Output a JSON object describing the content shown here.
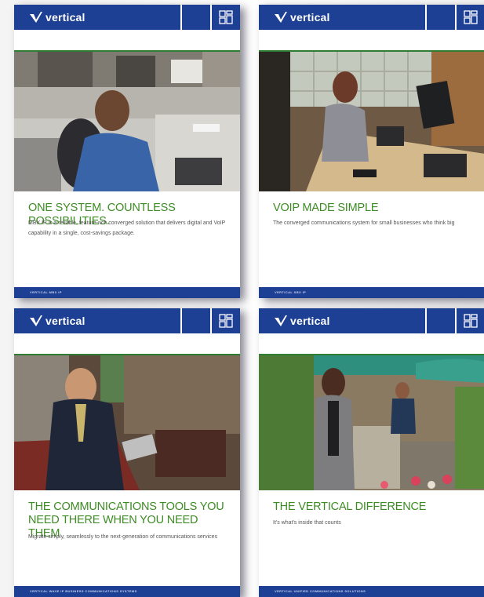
{
  "brand": {
    "logo_text": "vertical",
    "colors": {
      "primary": "#1d3f94",
      "headline": "#3d8b24",
      "body": "#555555"
    }
  },
  "brochures": [
    {
      "headline": "ONE SYSTEM. COUNTLESS POSSIBILITIES.",
      "body": "MBX IP is a reliable, feature-rich converged solution that delivers digital and VoIP capability in a single, cost-savings package.",
      "footer": "VERTICAL MBX IP",
      "photo": "man-on-phone-office-cubicle"
    },
    {
      "headline": "VOIP MADE SIMPLE",
      "body": "The converged communications system for small businesses who think big",
      "footer": "VERTICAL SBX IP",
      "photo": "woman-on-phone-at-desk"
    },
    {
      "headline": "THE COMMUNICATIONS TOOLS YOU NEED THERE WHEN YOU NEED THEM",
      "body": "Migrate simply, seamlessly to the next-generation of communications services",
      "footer": "VERTICAL WAVE IP BUSINESS COMMUNICATIONS SYSTEMS",
      "photo": "man-with-tablet-in-lounge"
    },
    {
      "headline": "THE VERTICAL DIFFERENCE",
      "body": "It's what's inside that counts",
      "footer": "VERTICAL UNIFIED COMMUNICATIONS SOLUTIONS",
      "photo": "woman-on-phone-outdoor-patio"
    }
  ],
  "icons": {
    "logo": "vertical-check-logo-icon",
    "menu": "grid-menu-icon"
  }
}
